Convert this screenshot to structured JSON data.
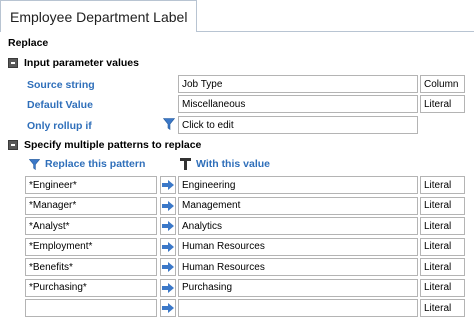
{
  "tab": {
    "label": "Employee Department Label"
  },
  "section": {
    "title": "Replace"
  },
  "input_params": {
    "header": "Input parameter values",
    "rows": [
      {
        "label": "Source string",
        "value": "Job Type",
        "type": "Column"
      },
      {
        "label": "Default Value",
        "value": "Miscellaneous",
        "type": "Literal"
      },
      {
        "label": "Only rollup if",
        "value": "Click to edit"
      }
    ]
  },
  "patterns": {
    "header": "Specify multiple patterns to replace",
    "col_pattern": "Replace this pattern",
    "col_value": "With this value",
    "rows": [
      {
        "pattern": "*Engineer*",
        "value": "Engineering",
        "type": "Literal"
      },
      {
        "pattern": "*Manager*",
        "value": "Management",
        "type": "Literal"
      },
      {
        "pattern": "*Analyst*",
        "value": "Analytics",
        "type": "Literal"
      },
      {
        "pattern": "*Employment*",
        "value": "Human Resources",
        "type": "Literal"
      },
      {
        "pattern": "*Benefits*",
        "value": "Human Resources",
        "type": "Literal"
      },
      {
        "pattern": "*Purchasing*",
        "value": "Purchasing",
        "type": "Literal"
      },
      {
        "pattern": "",
        "value": "",
        "type": "Literal"
      }
    ]
  },
  "colors": {
    "accent_blue": "#2f6fba",
    "arrow_blue": "#3b78c8",
    "border": "#b4b4b4"
  },
  "icons": [
    "minus-box-icon",
    "filter-icon",
    "text-T-icon",
    "right-arrow-icon"
  ]
}
